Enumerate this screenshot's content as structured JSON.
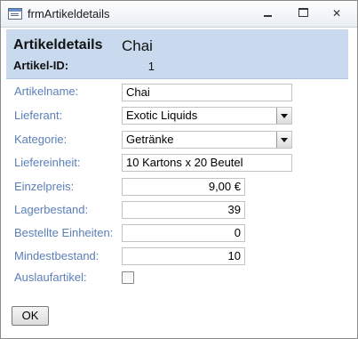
{
  "window": {
    "title": "frmArtikeldetails",
    "icon": "form-icon",
    "controls": [
      "minimize-icon",
      "maximize-icon",
      "close-icon"
    ]
  },
  "header": {
    "caption": "Artikeldetails",
    "product_name": "Chai",
    "id_label": "Artikel-ID:",
    "id_value": "1"
  },
  "fields": {
    "artikelname": {
      "label": "Artikelname:",
      "value": "Chai"
    },
    "lieferant": {
      "label": "Lieferant:",
      "value": "Exotic Liquids"
    },
    "kategorie": {
      "label": "Kategorie:",
      "value": "Getränke"
    },
    "liefereinheit": {
      "label": "Liefereinheit:",
      "value": "10 Kartons x 20 Beutel"
    },
    "einzelpreis": {
      "label": "Einzelpreis:",
      "value": "9,00 €"
    },
    "lagerbestand": {
      "label": "Lagerbestand:",
      "value": "39"
    },
    "bestellte_einheiten": {
      "label": "Bestellte Einheiten:",
      "value": "0"
    },
    "mindestbestand": {
      "label": "Mindestbestand:",
      "value": "10"
    },
    "auslaufartikel": {
      "label": "Auslaufartikel:",
      "checked": false
    }
  },
  "buttons": {
    "ok": "OK"
  },
  "colors": {
    "header_background": "#c9daee",
    "label_text": "#5b7fb8",
    "window_background": "#f0f0f0"
  }
}
